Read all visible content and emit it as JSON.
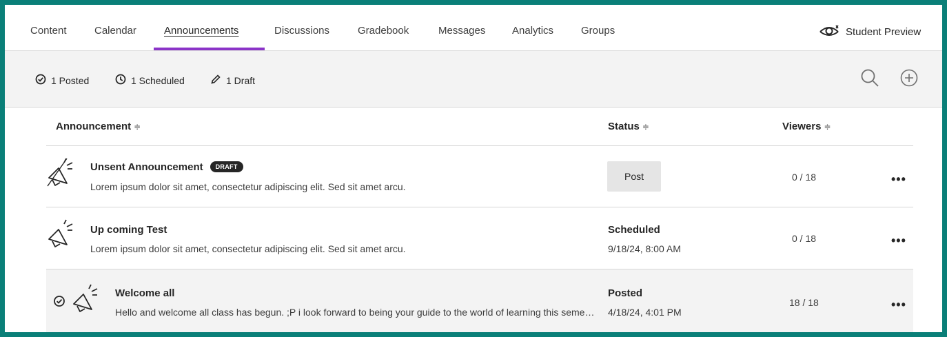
{
  "nav": {
    "tabs": [
      {
        "label": "Content"
      },
      {
        "label": "Calendar"
      },
      {
        "label": "Announcements",
        "active": true
      },
      {
        "label": "Discussions"
      },
      {
        "label": "Gradebook"
      },
      {
        "label": "Messages"
      },
      {
        "label": "Analytics"
      },
      {
        "label": "Groups"
      }
    ],
    "student_preview": "Student Preview",
    "accent_color": "#8b34c8"
  },
  "summary": {
    "posted": "1 Posted",
    "scheduled": "1 Scheduled",
    "draft": "1 Draft",
    "search_icon": "search-icon",
    "add_icon": "add-circle-icon"
  },
  "table": {
    "headers": {
      "announcement": "Announcement",
      "status": "Status",
      "viewers": "Viewers",
      "sort_glyph": "≑"
    },
    "rows": [
      {
        "title": "Unsent Announcement",
        "badge": "DRAFT",
        "description": "Lorem ipsum dolor sit amet, consectetur adipiscing elit. Sed sit amet arcu.",
        "status_button": "Post",
        "viewers": "0 / 18",
        "more": "•••"
      },
      {
        "title": "Up coming Test",
        "description": "Lorem ipsum dolor sit amet, consectetur adipiscing elit. Sed sit amet arcu.",
        "status": "Scheduled",
        "status_date": "9/18/24, 8:00 AM",
        "viewers": "0 / 18",
        "more": "•••"
      },
      {
        "title": "Welcome all",
        "description": "Hello and welcome all class has begun. ;P i look forward to being your guide to the world of learning this semester.",
        "status": "Posted",
        "status_date": "4/18/24, 4:01 PM",
        "viewers": "18 / 18",
        "more": "•••"
      }
    ]
  },
  "colors": {
    "frame_border": "#0a7f78",
    "row_highlight": "#f3f3f3",
    "summary_bg": "#f3f3f3"
  }
}
